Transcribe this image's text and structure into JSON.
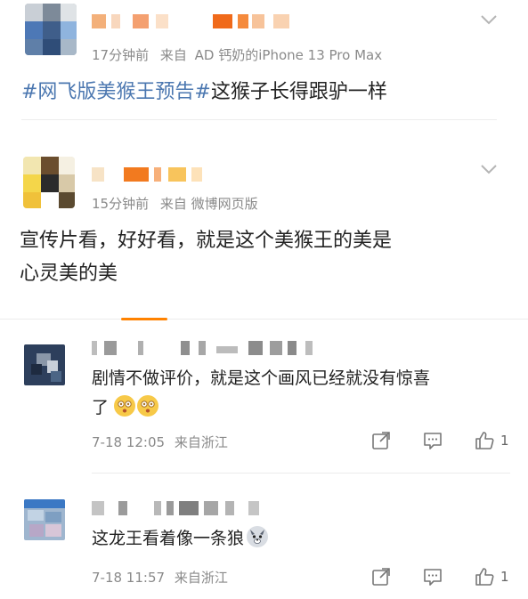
{
  "posts": [
    {
      "meta_time": "17分钟前",
      "meta_source_prefix": "来自",
      "meta_source": "AD 钙奶的iPhone 13 Pro Max",
      "hashtag": "#网飞版美猴王预告#",
      "text": "这猴子长得跟驴一样"
    },
    {
      "meta_time": "15分钟前",
      "meta_source_prefix": "来自",
      "meta_source": "微博网页版",
      "text_line1": "宣传片看，好好看，就是这个美猴王的美是",
      "text_line2": "心灵美的美"
    }
  ],
  "comments": [
    {
      "text_line1": "剧情不做评价，就是这个画风已经就没有惊喜",
      "text_line2": "了",
      "emojis": [
        "dizzy-face-emoji",
        "dizzy-face-emoji"
      ],
      "time": "7-18 12:05",
      "location": "来自浙江",
      "likes": "1"
    },
    {
      "text_line1": "这龙王看着像一条狼",
      "emojis": [
        "wolf-face-emoji"
      ],
      "time": "7-18 11:57",
      "location": "来自浙江",
      "likes": "1"
    }
  ],
  "colors": {
    "hashtag": "#4b77b0",
    "accent": "#ff8200",
    "meta": "#8a8a8a"
  },
  "icons": [
    "chevron-down-icon",
    "share-icon",
    "comment-icon",
    "like-icon"
  ]
}
